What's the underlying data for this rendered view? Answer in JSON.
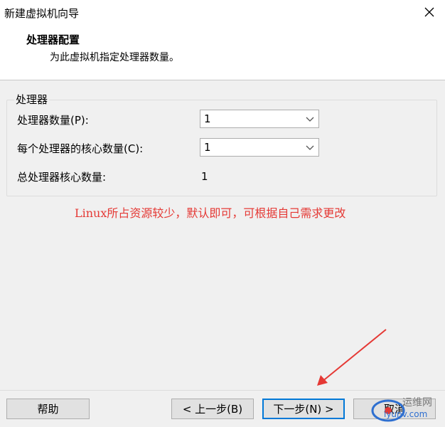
{
  "window": {
    "title": "新建虚拟机向导"
  },
  "header": {
    "title": "处理器配置",
    "subtitle": "为此虚拟机指定处理器数量。"
  },
  "group": {
    "label": "处理器",
    "processor_count_label": "处理器数量(P):",
    "processor_count_value": "1",
    "cores_label": "每个处理器的核心数量(C):",
    "cores_value": "1",
    "total_label": "总处理器核心数量:",
    "total_value": "1"
  },
  "annotation": {
    "text": "Linux所占资源较少，默认即可，可根据自己需求更改",
    "color": "#e53935"
  },
  "buttons": {
    "help": "帮助",
    "back": "< 上一步(B)",
    "next": "下一步(N) >",
    "cancel": "取消"
  },
  "watermark": {
    "line1": "运维网",
    "line2": "iyunv.com"
  },
  "icons": {
    "close": "close-icon",
    "dropdown": "chevron-down-icon"
  }
}
